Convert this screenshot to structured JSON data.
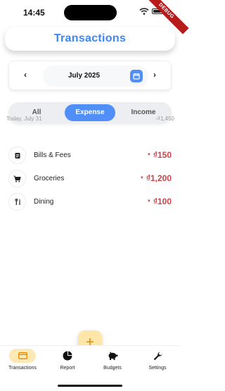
{
  "status": {
    "time": "14:45",
    "debug": "DEBUG"
  },
  "header": {
    "title": "Transactions"
  },
  "month": {
    "label": "July 2025",
    "prev_icon": "chevron-left-icon",
    "next_icon": "chevron-right-icon",
    "calendar_icon": "calendar-icon"
  },
  "tabs": [
    {
      "label": "All",
      "active": false
    },
    {
      "label": "Expense",
      "active": true
    },
    {
      "label": "Income",
      "active": false
    }
  ],
  "group": {
    "date": "Today, July 31",
    "total": "-₫1,450",
    "items": [
      {
        "icon": "receipt-icon",
        "name": "Bills & Fees",
        "amount": "₫150"
      },
      {
        "icon": "cart-icon",
        "name": "Groceries",
        "amount": "₫1,200"
      },
      {
        "icon": "cutlery-icon",
        "name": "Dining",
        "amount": "₫100"
      }
    ]
  },
  "nav": [
    {
      "label": "Transactions",
      "icon": "card-icon",
      "active": true
    },
    {
      "label": "Report",
      "icon": "pie-chart-icon",
      "active": false
    },
    {
      "label": "Budgets",
      "icon": "piggy-bank-icon",
      "active": false
    },
    {
      "label": "Settings",
      "icon": "wrench-icon",
      "active": false
    }
  ],
  "fab": {
    "label": "+"
  },
  "colors": {
    "accent": "#4f8ff7",
    "title": "#3f86f5",
    "expense": "#c9444b",
    "fab": "#fde6a8",
    "nav_active": "#fde9b6"
  }
}
